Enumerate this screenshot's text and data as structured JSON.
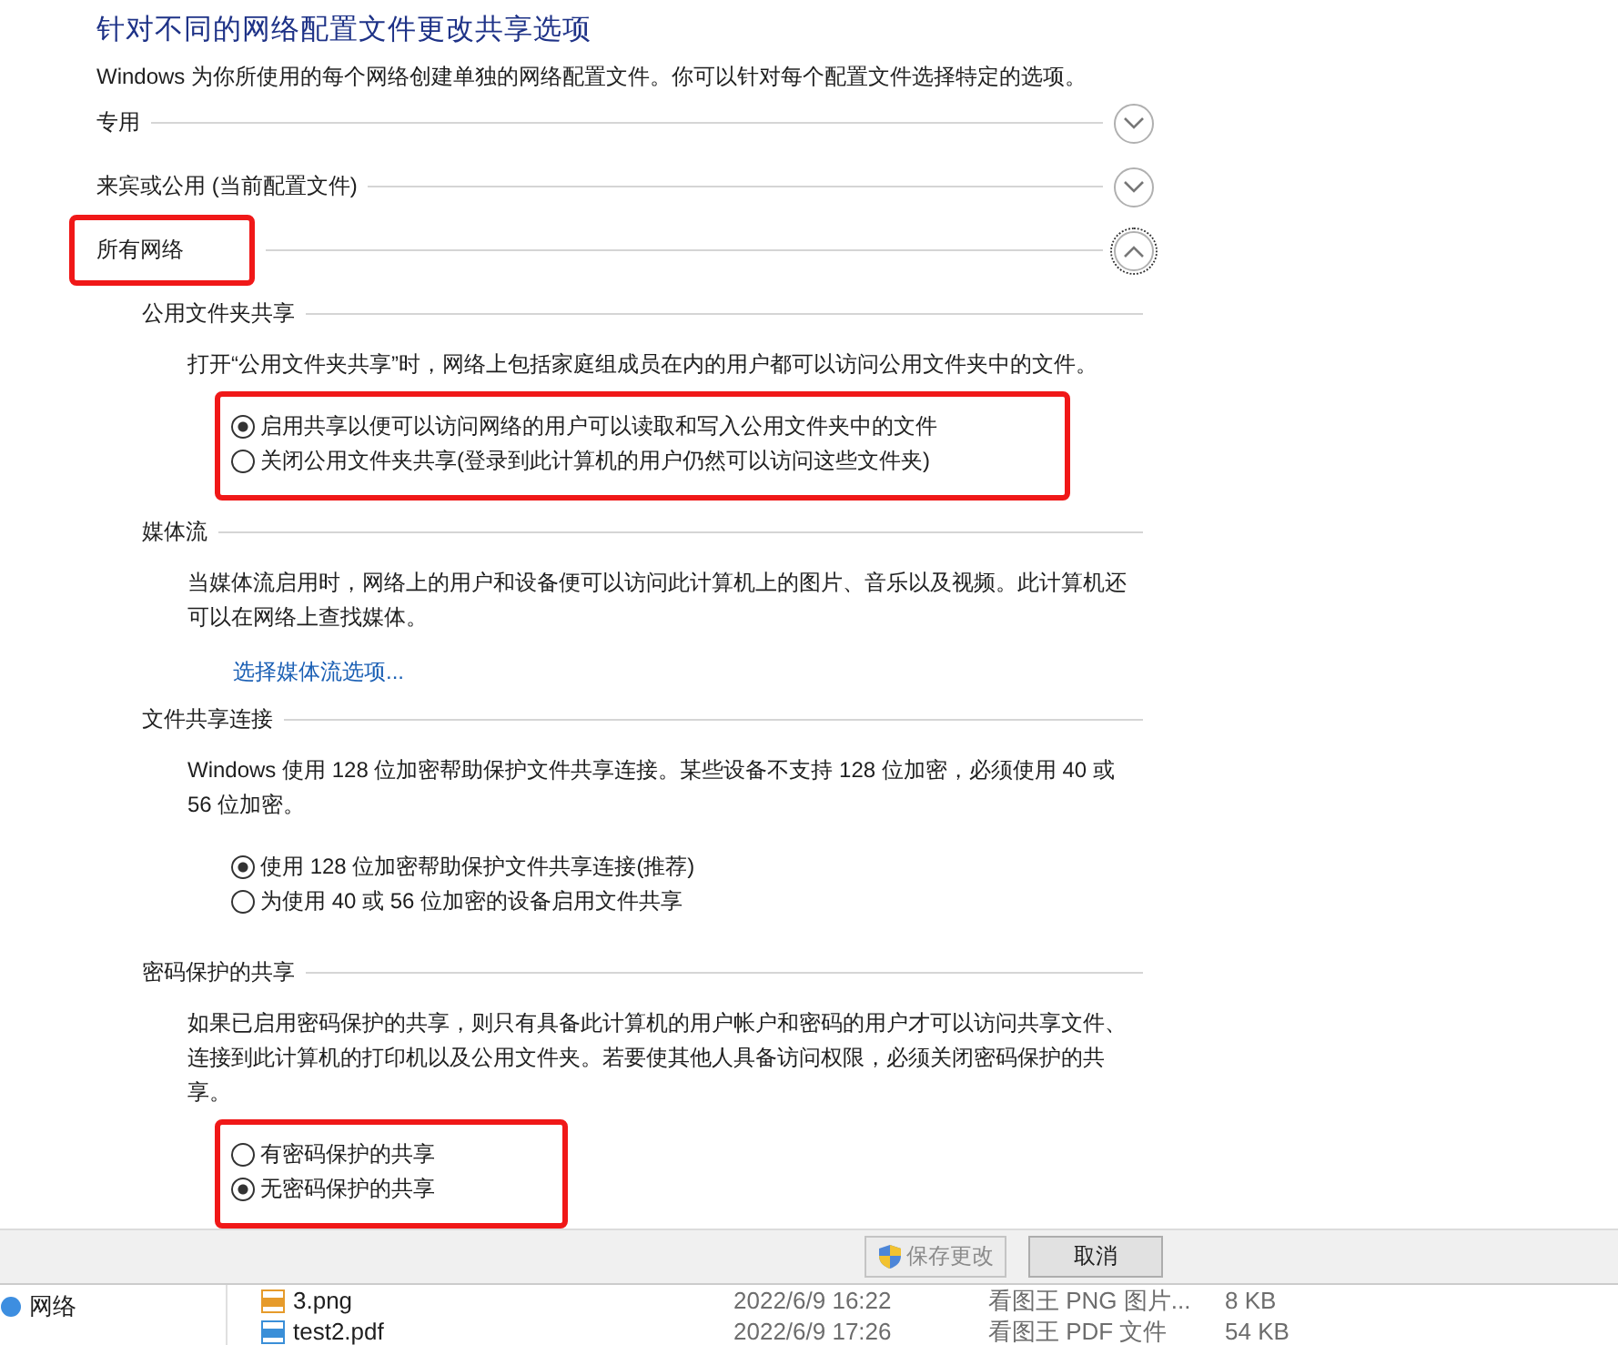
{
  "title": "针对不同的网络配置文件更改共享选项",
  "description": "Windows 为你所使用的每个网络创建单独的网络配置文件。你可以针对每个配置文件选择特定的选项。",
  "profiles": [
    {
      "label": "专用",
      "expanded": false,
      "annotated": false
    },
    {
      "label": "来宾或公用 (当前配置文件)",
      "expanded": false,
      "annotated": false
    },
    {
      "label": "所有网络",
      "expanded": true,
      "annotated": true
    }
  ],
  "sections": [
    {
      "heading": "公用文件夹共享",
      "paragraph": "打开“公用文件夹共享”时，网络上包括家庭组成员在内的用户都可以访问公用文件夹中的文件。",
      "options_annotated": true,
      "options": [
        {
          "label": "启用共享以便可以访问网络的用户可以读取和写入公用文件夹中的文件",
          "selected": true
        },
        {
          "label": "关闭公用文件夹共享(登录到此计算机的用户仍然可以访问这些文件夹)",
          "selected": false
        }
      ]
    },
    {
      "heading": "媒体流",
      "paragraph": "当媒体流启用时，网络上的用户和设备便可以访问此计算机上的图片、音乐以及视频。此计算机还可以在网络上查找媒体。",
      "link": "选择媒体流选项..."
    },
    {
      "heading": "文件共享连接",
      "paragraph": "Windows 使用 128 位加密帮助保护文件共享连接。某些设备不支持 128 位加密，必须使用 40 或 56 位加密。",
      "options_annotated": false,
      "options": [
        {
          "label": "使用 128 位加密帮助保护文件共享连接(推荐)",
          "selected": true
        },
        {
          "label": "为使用 40 或 56 位加密的设备启用文件共享",
          "selected": false
        }
      ]
    },
    {
      "heading": "密码保护的共享",
      "paragraph": "如果已启用密码保护的共享，则只有具备此计算机的用户帐户和密码的用户才可以访问共享文件、连接到此计算机的打印机以及公用文件夹。若要使其他人具备访问权限，必须关闭密码保护的共享。",
      "options_annotated": true,
      "options": [
        {
          "label": "有密码保护的共享",
          "selected": false
        },
        {
          "label": "无密码保护的共享",
          "selected": true
        }
      ]
    }
  ],
  "buttons": [
    {
      "label": "保存更改",
      "disabled": true,
      "kind": "shield"
    },
    {
      "label": "取消",
      "disabled": false,
      "kind": "plain"
    }
  ],
  "explorer": {
    "nav_item": "网络",
    "files": [
      {
        "name": "3.png",
        "modified": "2022/6/9 16:22",
        "type": "看图王 PNG 图片...",
        "size": "8 KB",
        "kind": "png"
      },
      {
        "name": "test2.pdf",
        "modified": "2022/6/9 17:26",
        "type": "看图王 PDF 文件",
        "size": "54 KB",
        "kind": "pdf"
      }
    ]
  }
}
